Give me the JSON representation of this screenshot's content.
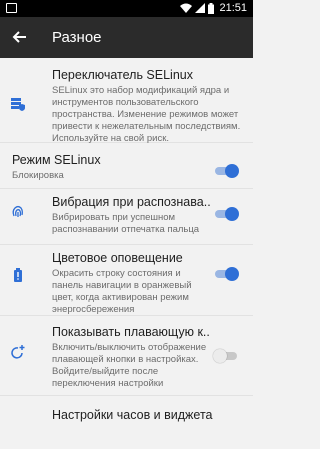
{
  "status_bar": {
    "time": "21:51"
  },
  "app_bar": {
    "title": "Разное"
  },
  "accent": "#2f6fd6",
  "items": [
    {
      "icon": "server-shield-icon",
      "title": "Переключатель SELinux",
      "summary": "SELinux это набор модификаций ядра и инструментов пользовательского пространства. Изменение режимов может привести к нежелательным последствиям. Используйте на свой риск."
    },
    {
      "title": "Режим SELinux",
      "summary": "Блокировка",
      "toggle": true
    },
    {
      "icon": "fingerprint-icon",
      "title": "Вибрация при распознава..",
      "summary": "Вибрировать при успешном распознавании отпечатка пальца",
      "toggle": true
    },
    {
      "icon": "battery-alert-icon",
      "title": "Цветовое оповещение",
      "summary": "Окрасить строку состояния и панель навигации в оранжевый цвет, когда активирован режим энергосбережения",
      "toggle": true
    },
    {
      "icon": "rotate-add-icon",
      "title": "Показывать плавающую к..",
      "summary": "Включить/выключить отображение плавающей кнопки в настройках. Войдите/выйдите после переключения настройки",
      "toggle": false
    },
    {
      "title": "Настройки часов и виджета"
    }
  ]
}
